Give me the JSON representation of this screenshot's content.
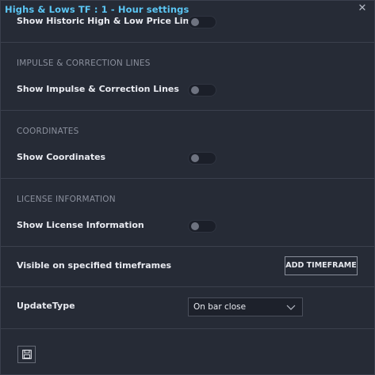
{
  "window": {
    "title": "Highs & Lows TF : 1 - Hour settings",
    "close_icon": "close-icon"
  },
  "settings": {
    "historic_label": "Show Historic High & Low Price Lines",
    "historic_on": false,
    "impulse_section": "IMPULSE & CORRECTION LINES",
    "impulse_label": "Show Impulse & Correction Lines",
    "impulse_on": false,
    "coordinates_section": "COORDINATES",
    "coordinates_label": "Show Coordinates",
    "coordinates_on": false,
    "license_section": "LICENSE INFORMATION",
    "license_label": "Show License Information",
    "license_on": false,
    "timeframes_label": "Visible on specified timeframes",
    "add_timeframe_button": "ADD TIMEFRAME",
    "update_type_label": "UpdateType",
    "update_type_value": "On bar close"
  },
  "footer": {
    "save_icon": "save-icon"
  },
  "colors": {
    "accent": "#5bc6f4",
    "background": "#262b36",
    "toggle_off": "#1b1f29"
  }
}
